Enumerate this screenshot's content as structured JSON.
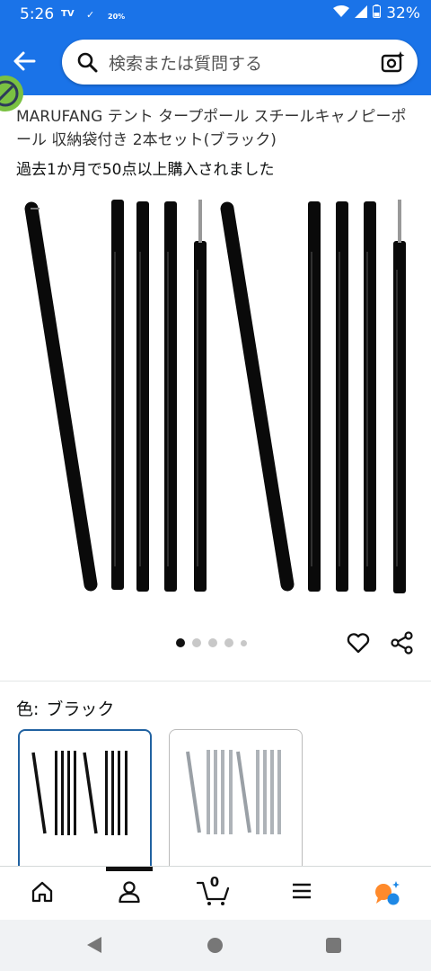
{
  "status_bar": {
    "time": "5:26",
    "indicator_1": "TV",
    "indicator_2": "20%",
    "battery": "32%"
  },
  "search": {
    "placeholder": "検索または質問する"
  },
  "product": {
    "title": "MARUFANG テント タープポール スチールキャノピーポール 収納袋付き 2本セット(ブラック)",
    "bought_note": "過去1か月で50点以上購入されました",
    "image_pages": 5,
    "active_page": 1
  },
  "color": {
    "label": "色:",
    "selected": "ブラック"
  },
  "bottom_nav": {
    "cart_count": "0",
    "items": [
      "home-icon",
      "account-icon",
      "cart-icon",
      "menu-icon",
      "rufus-icon"
    ]
  },
  "colors": {
    "brand_blue": "#1a73e8",
    "selected_border": "#2162a1",
    "rufus_orange": "#ff8a2b",
    "rufus_blue": "#1e88e5"
  }
}
